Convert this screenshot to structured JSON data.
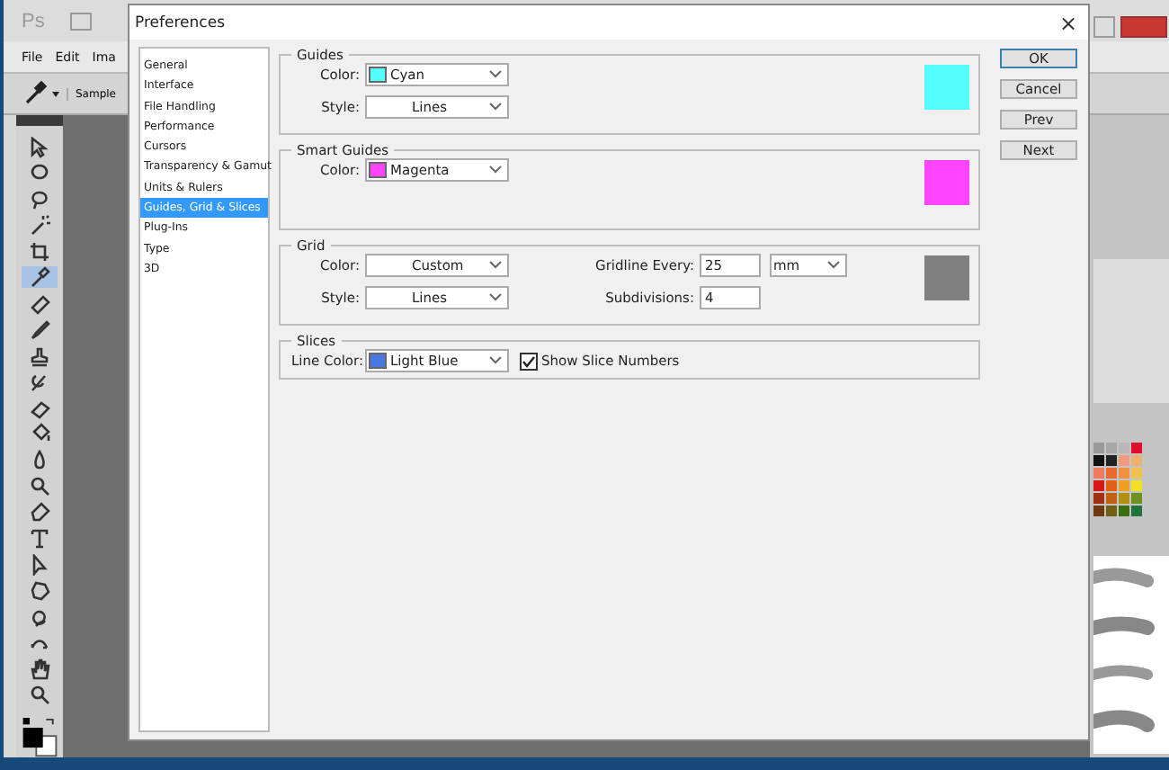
{
  "app": {
    "logo": "Ps",
    "menu": [
      "File",
      "Edit",
      "Ima"
    ],
    "options_label": "Sample"
  },
  "toolbar": {
    "tools": [
      {
        "selected": false
      },
      {
        "selected": false
      },
      {
        "selected": false
      },
      {
        "selected": false
      },
      {
        "selected": false
      },
      {
        "selected": true
      },
      {
        "selected": false
      },
      {
        "selected": false
      },
      {
        "selected": false
      },
      {
        "selected": false
      },
      {
        "selected": false
      },
      {
        "selected": false
      },
      {
        "selected": false
      },
      {
        "selected": false
      },
      {
        "selected": false
      },
      {
        "selected": false
      },
      {
        "selected": false
      },
      {
        "selected": false
      },
      {
        "selected": false
      },
      {
        "selected": false
      },
      {
        "selected": false
      },
      {
        "selected": false
      }
    ]
  },
  "swatches": [
    {
      "color": "#9a9a9a"
    },
    {
      "color": "#a8a8a8"
    },
    {
      "color": "#b8b8b8"
    },
    {
      "color": "#e0102a"
    },
    {
      "color": "#111111"
    },
    {
      "color": "#222222"
    },
    {
      "color": "#f09a80"
    },
    {
      "color": "#f0b070"
    },
    {
      "color": "#f07a60"
    },
    {
      "color": "#e86a30"
    },
    {
      "color": "#f09040"
    },
    {
      "color": "#f0c050"
    },
    {
      "color": "#d81818"
    },
    {
      "color": "#e06018"
    },
    {
      "color": "#f0a020"
    },
    {
      "color": "#f0e020"
    },
    {
      "color": "#a03010"
    },
    {
      "color": "#c06010"
    },
    {
      "color": "#b09010"
    },
    {
      "color": "#709020"
    },
    {
      "color": "#703810"
    },
    {
      "color": "#706010"
    },
    {
      "color": "#3a7010"
    },
    {
      "color": "#207040"
    }
  ],
  "dialog": {
    "title": "Preferences",
    "close": "×",
    "sidebar": [
      {
        "label": "General",
        "selected": false
      },
      {
        "label": "Interface",
        "selected": false
      },
      {
        "label": "File Handling",
        "selected": false
      },
      {
        "label": "Performance",
        "selected": false
      },
      {
        "label": "Cursors",
        "selected": false
      },
      {
        "label": "Transparency & Gamut",
        "selected": false
      },
      {
        "label": "Units & Rulers",
        "selected": false
      },
      {
        "label": "Guides, Grid & Slices",
        "selected": true
      },
      {
        "label": "Plug-Ins",
        "selected": false
      },
      {
        "label": "Type",
        "selected": false
      },
      {
        "label": "3D",
        "selected": false
      }
    ],
    "sections": [
      {
        "title": "Guides",
        "color": "#55ffff",
        "rows": [
          {
            "label": "Color:",
            "field": {
              "kind": "select",
              "value": "Cyan",
              "color": "#55ffff"
            }
          },
          {
            "label": "Style:",
            "field": {
              "kind": "select",
              "value": "Lines"
            }
          }
        ]
      },
      {
        "title": "Smart Guides",
        "color": "#ff44ff",
        "rows": [
          {
            "label": "Color:",
            "field": {
              "kind": "select",
              "value": "Magenta",
              "color": "#ff44ff"
            }
          }
        ]
      },
      {
        "title": "Grid",
        "color": "#808080",
        "rows": [
          {
            "label": "Color:",
            "field": {
              "kind": "select",
              "value": "Custom"
            },
            "right_label": "Gridline Every:",
            "right_input": "25",
            "right_select": "mm"
          },
          {
            "label": "Style:",
            "field": {
              "kind": "select",
              "value": "Lines"
            },
            "right_label": "Subdivisions:",
            "right_input": "4"
          }
        ]
      },
      {
        "title": "Slices",
        "rows": [
          {
            "label": "Line Color:",
            "field": {
              "kind": "select",
              "value": "Light Blue",
              "color": "#4a78e0"
            },
            "checkbox": {
              "label": "Show Slice Numbers",
              "checked": true
            }
          }
        ]
      }
    ],
    "buttons": [
      {
        "label": "OK",
        "default": true
      },
      {
        "label": "Cancel",
        "default": false
      },
      {
        "label": "Prev",
        "default": false
      },
      {
        "label": "Next",
        "default": false
      }
    ]
  }
}
